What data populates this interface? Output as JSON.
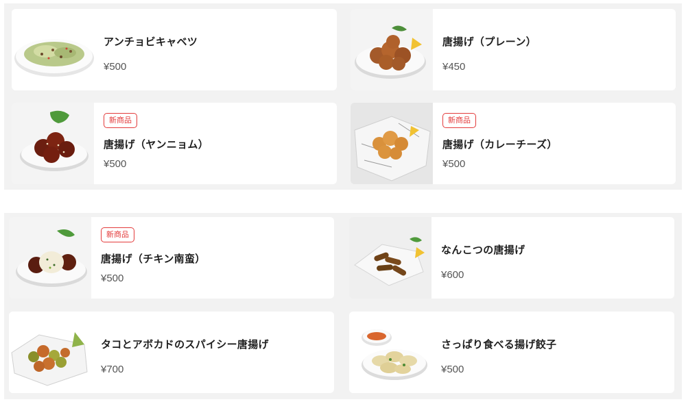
{
  "sections": [
    {
      "items": [
        {
          "name": "アンチョビキャベツ",
          "price": "¥500",
          "badge": "",
          "image": "anchovy-cabbage-plate-image"
        },
        {
          "name": "唐揚げ（プレーン）",
          "price": "¥450",
          "badge": "",
          "image": "karaage-plain-plate-image"
        },
        {
          "name": "唐揚げ（ヤンニョム）",
          "price": "¥500",
          "badge": "新商品",
          "image": "karaage-yangnyeom-plate-image"
        },
        {
          "name": "唐揚げ（カレーチーズ）",
          "price": "¥500",
          "badge": "新商品",
          "image": "karaage-curry-cheese-basket-image"
        }
      ]
    },
    {
      "items": [
        {
          "name": "唐揚げ（チキン南蛮）",
          "price": "¥500",
          "badge": "新商品",
          "image": "karaage-chicken-nanban-plate-image"
        },
        {
          "name": "なんこつの唐揚げ",
          "price": "¥600",
          "badge": "",
          "image": "nankotsu-karaage-plate-image"
        },
        {
          "name": "タコとアボカドのスパイシー唐揚げ",
          "price": "¥700",
          "badge": "",
          "image": "octopus-avocado-karaage-image"
        },
        {
          "name": "さっぱり食べる揚げ餃子",
          "price": "¥500",
          "badge": "",
          "image": "fried-gyoza-plate-image"
        }
      ]
    }
  ],
  "colors": {
    "section_bg": "#f2f2f2",
    "card_bg": "#ffffff",
    "badge": "#e33a3a",
    "price": "#555555"
  }
}
